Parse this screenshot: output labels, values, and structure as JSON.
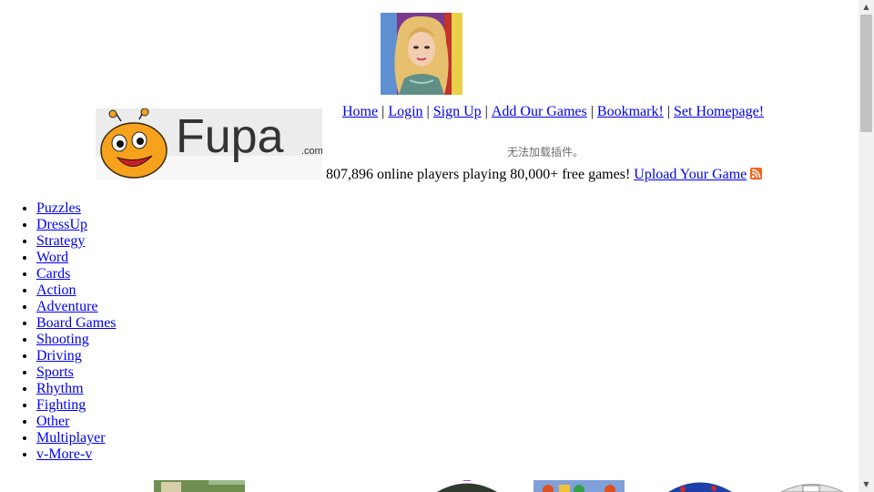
{
  "header": {
    "logo_text": "Fupa",
    "logo_suffix": ".com"
  },
  "nav": {
    "items": [
      {
        "label": "Home"
      },
      {
        "label": "Login"
      },
      {
        "label": "Sign Up"
      },
      {
        "label": "Add Our Games"
      },
      {
        "label": "Bookmark!"
      },
      {
        "label": "Set Homepage!"
      }
    ],
    "separator": "|"
  },
  "plugin_message": "无法加载插件。",
  "stats": {
    "text": "807,896 online players playing 80,000+ free games!",
    "upload_label": "Upload Your Game"
  },
  "categories": [
    {
      "label": "Puzzles"
    },
    {
      "label": "DressUp"
    },
    {
      "label": "Strategy"
    },
    {
      "label": "Word"
    },
    {
      "label": "Cards"
    },
    {
      "label": "Action"
    },
    {
      "label": "Adventure"
    },
    {
      "label": "Board Games"
    },
    {
      "label": "Shooting"
    },
    {
      "label": "Driving"
    },
    {
      "label": "Sports"
    },
    {
      "label": "Rhythm"
    },
    {
      "label": "Fighting"
    },
    {
      "label": "Other"
    },
    {
      "label": "Multiplayer"
    },
    {
      "label": "v-More-v"
    }
  ],
  "colors": {
    "link": "#0000ee",
    "plugin_text": "#6e6e6e",
    "rss": "#f26522",
    "mascot": "#f6a21d"
  },
  "icons": {
    "rss": "rss-feed-icon",
    "scroll_up": "scroll-up-arrow-icon",
    "scroll_down": "scroll-down-arrow-icon"
  }
}
